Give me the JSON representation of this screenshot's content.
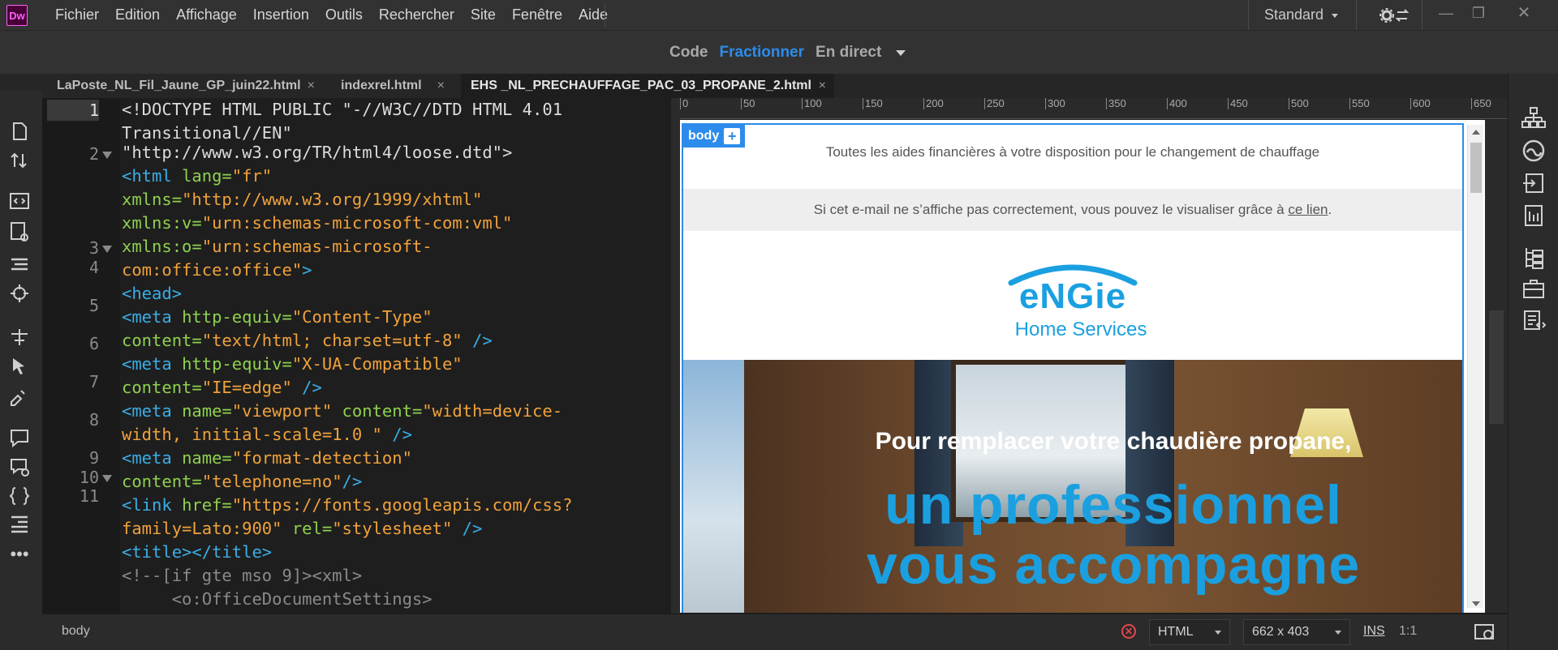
{
  "app": {
    "logo": "Dw",
    "workspace": "Standard"
  },
  "menu": [
    "Fichier",
    "Edition",
    "Affichage",
    "Insertion",
    "Outils",
    "Rechercher",
    "Site",
    "Fenêtre",
    "Aide"
  ],
  "view_modes": {
    "code": "Code",
    "split": "Fractionner",
    "live": "En direct"
  },
  "tabs": [
    {
      "label": "LaPoste_NL_Fil_Jaune_GP_juin22.html",
      "close": "×"
    },
    {
      "label": "indexrel.html",
      "close": "×"
    },
    {
      "label": "EHS _NL_PRECHAUFFAGE_PAC_03_PROPANE_2.html",
      "close": "×",
      "active": true
    }
  ],
  "collapse_glyph": "‹‹",
  "line_numbers": [
    "1",
    "2",
    "3",
    "4",
    "5",
    "6",
    "7",
    "8",
    "9",
    "10",
    "11"
  ],
  "code": {
    "l1a": "<!DOCTYPE HTML PUBLIC \"-//W3C//DTD HTML 4.01",
    "l1b": "Transitional//EN\"",
    "l1c": "\"http://www.w3.org/TR/html4/loose.dtd\">",
    "l2a_tag": "<html ",
    "l2a_attr": "lang=",
    "l2a_val": "\"fr\"",
    "l2b_attr": "xmlns=",
    "l2b_val": "\"http://www.w3.org/1999/xhtml\"",
    "l2c_attr": "xmlns:v=",
    "l2c_val": "\"urn:schemas-microsoft-com:vml\"",
    "l2d_attr": "xmlns:o=",
    "l2d_val": "\"urn:schemas-microsoft-",
    "l2e_val": "com:office:office\"",
    "l2e_tag": ">",
    "l3": "<head>",
    "l4a_tag": "<meta ",
    "l4a_attr": "http-equiv=",
    "l4a_val": "\"Content-Type\"",
    "l4b_attr": "content=",
    "l4b_val": "\"text/html; charset=utf-8\"",
    "l4b_tag": " />",
    "l5a_tag": "<meta ",
    "l5a_attr": "http-equiv=",
    "l5a_val": "\"X-UA-Compatible\"",
    "l5b_attr": "content=",
    "l5b_val": "\"IE=edge\"",
    "l5b_tag": " />",
    "l6a_tag": "<meta ",
    "l6a_attr": "name=",
    "l6a_val": "\"viewport\"",
    "l6a_attr2": " content=",
    "l6a_val2": "\"width=device-",
    "l6b_val": "width, initial-scale=1.0 \"",
    "l6b_tag": " />",
    "l7a_tag": "<meta ",
    "l7a_attr": "name=",
    "l7a_val": "\"format-detection\"",
    "l7b_attr": "content=",
    "l7b_val": "\"telephone=no\"",
    "l7b_tag": "/>",
    "l8a_tag": "<link ",
    "l8a_attr": "href=",
    "l8a_val": "\"https://fonts.googleapis.com/css?",
    "l8b_val": "family=Lato:900\"",
    "l8b_attr": " rel=",
    "l8b_val2": "\"stylesheet\"",
    "l8b_tag": " />",
    "l9": "<title></title>",
    "l10": "<!--[if gte mso 9]><xml>",
    "l11": "     <o:OfficeDocumentSettings>"
  },
  "ruler": [
    "0",
    "50",
    "100",
    "150",
    "200",
    "250",
    "300",
    "350",
    "400",
    "450",
    "500",
    "550",
    "600",
    "650"
  ],
  "design": {
    "body_tag": "body",
    "plus": "+",
    "preheader": "Toutes les aides financières à votre disposition pour le changement de chauffage",
    "view_online_text": "Si cet e-mail ne s’affiche pas correctement, vous pouvez le visualiser grâce à ",
    "view_online_link": "ce lien",
    "view_online_end": ".",
    "logo_word": "eNGie",
    "logo_sub": "Home Services",
    "hero_line1": "Pour remplacer votre chaudière propane,",
    "hero_line2": "un professionnel",
    "hero_line3": "vous accompagne"
  },
  "status": {
    "tag": "body",
    "doc_type": "HTML",
    "size": "662 x 403",
    "ins": "INS",
    "ratio": "1:1"
  },
  "colors": {
    "accent": "#2d8ceb",
    "active_mode": "#2d8ceb",
    "brand_blue": "#1aa0e0"
  }
}
